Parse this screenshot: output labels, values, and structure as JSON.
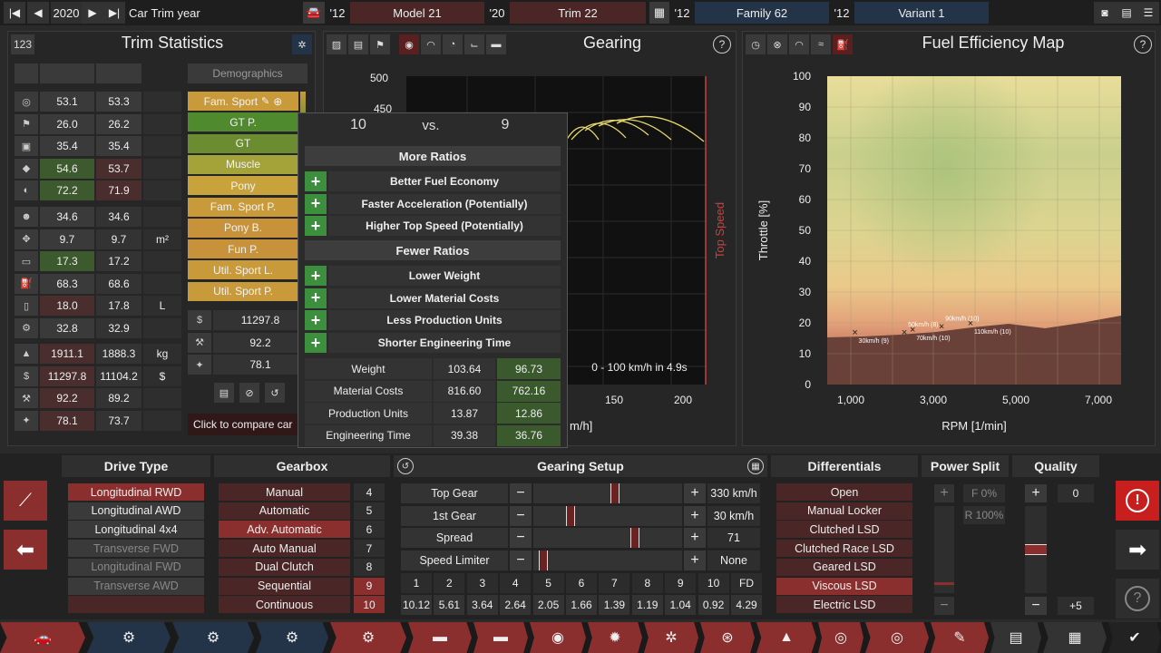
{
  "topbar": {
    "year": "2020",
    "year_label": "Car Trim year",
    "model_year": "'12",
    "model": "Model 21",
    "trim_year": "'20",
    "trim": "Trim 22",
    "family_year": "'12",
    "family": "Family 62",
    "variant_year": "'12",
    "variant": "Variant 1"
  },
  "trim_stats": {
    "badge": "123",
    "title": "Trim Statistics",
    "demographics_label": "Demographics",
    "rows_a": [
      {
        "icon": "steering-icon",
        "v1": "53.1",
        "v2": "53.3",
        "unit": "",
        "c1": "#3a3a3a",
        "c2": "#3a3a3a"
      },
      {
        "icon": "race-flag-icon",
        "v1": "26.0",
        "v2": "26.2",
        "unit": "",
        "c1": "#3a3a3a",
        "c2": "#3a3a3a"
      },
      {
        "icon": "seat-icon",
        "v1": "35.4",
        "v2": "35.4",
        "unit": "",
        "c1": "#3a3a3a",
        "c2": "#3a3a3a"
      },
      {
        "icon": "diamond-icon",
        "v1": "54.6",
        "v2": "53.7",
        "unit": "",
        "c1": "#3d5a2e",
        "c2": "#4a2e2e"
      },
      {
        "icon": "safety-icon",
        "v1": "72.2",
        "v2": "71.9",
        "unit": "",
        "c1": "#3d5a2e",
        "c2": "#4a2e2e"
      }
    ],
    "rows_b": [
      {
        "icon": "passengers-icon",
        "v1": "34.6",
        "v2": "34.6",
        "unit": ""
      },
      {
        "icon": "dimensions-icon",
        "v1": "9.7",
        "v2": "9.7",
        "unit": "m²"
      },
      {
        "icon": "cargo-icon",
        "v1": "17.3",
        "v2": "17.2",
        "unit": "",
        "c1": "#3d5a2e"
      },
      {
        "icon": "fuel-icon",
        "v1": "68.3",
        "v2": "68.6",
        "unit": ""
      },
      {
        "icon": "fuel-tank-icon",
        "v1": "18.0",
        "v2": "17.8",
        "unit": "L",
        "c1": "#4a2e2e"
      },
      {
        "icon": "car-service-icon",
        "v1": "32.8",
        "v2": "32.9",
        "unit": ""
      }
    ],
    "rows_c": [
      {
        "icon": "weight-icon",
        "v1": "1911.1",
        "v2": "1888.3",
        "unit": "kg",
        "c1": "#4a2e2e"
      },
      {
        "icon": "cost-icon",
        "v1": "11297.8",
        "v2": "11104.2",
        "unit": "$",
        "c1": "#4a2e2e"
      },
      {
        "icon": "production-icon",
        "v1": "92.2",
        "v2": "89.2",
        "unit": "",
        "c1": "#4a2e2e"
      },
      {
        "icon": "engineering-icon",
        "v1": "78.1",
        "v2": "73.7",
        "unit": "",
        "c1": "#4a2e2e"
      }
    ],
    "demographics": [
      {
        "label": "Fam. Sport",
        "color": "#c89a3a"
      },
      {
        "label": "GT P.",
        "color": "#4f8a2e"
      },
      {
        "label": "GT",
        "color": "#6b8c30"
      },
      {
        "label": "Muscle",
        "color": "#a3a33a"
      },
      {
        "label": "Pony",
        "color": "#c8a23a"
      },
      {
        "label": "Fam. Sport P.",
        "color": "#c89a3a"
      },
      {
        "label": "Pony B.",
        "color": "#c8923a"
      },
      {
        "label": "Fun P.",
        "color": "#c8923a"
      },
      {
        "label": "Util. Sport L.",
        "color": "#c89a3a"
      },
      {
        "label": "Util. Sport P.",
        "color": "#c89a3a"
      }
    ],
    "summary": [
      {
        "icon": "cost-icon",
        "value": "11297.8"
      },
      {
        "icon": "production-icon",
        "value": "92.2"
      },
      {
        "icon": "engineering-icon",
        "value": "78.1"
      }
    ],
    "compare_text": "Click to compare car"
  },
  "popup": {
    "left": "10",
    "vs": "vs.",
    "right": "9",
    "more_title": "More Ratios",
    "more": [
      "Better Fuel Economy",
      "Faster Acceleration (Potentially)",
      "Higher Top Speed (Potentially)"
    ],
    "fewer_title": "Fewer Ratios",
    "fewer": [
      "Lower Weight",
      "Lower Material Costs",
      "Less Production Units",
      "Shorter Engineering Time"
    ],
    "stats": [
      {
        "label": "Weight",
        "a": "103.64",
        "b": "96.73"
      },
      {
        "label": "Material Costs",
        "a": "816.60",
        "b": "762.16"
      },
      {
        "label": "Production Units",
        "a": "13.87",
        "b": "12.86"
      },
      {
        "label": "Engineering Time",
        "a": "39.38",
        "b": "36.76"
      }
    ]
  },
  "gearing": {
    "title": "Gearing",
    "y_ticks": [
      "500",
      "450"
    ],
    "x_ticks": [
      "150",
      "200"
    ],
    "x_label_partial": "m/h]",
    "top_speed_label": "Top Speed",
    "accel_text": "0 - 100 km/h in 4.9s"
  },
  "fuel_map": {
    "title": "Fuel Efficiency Map",
    "ylabel": "Throttle [%]",
    "xlabel": "RPM [1/min]",
    "y_ticks": [
      "100",
      "90",
      "80",
      "70",
      "60",
      "50",
      "40",
      "30",
      "20",
      "10",
      "0"
    ],
    "x_ticks": [
      "1,000",
      "3,000",
      "5,000",
      "7,000"
    ],
    "points": [
      {
        "label": "30km/h (9)",
        "rpm": 1100,
        "thr": 17
      },
      {
        "label": "50km/h (8)",
        "rpm": 2300,
        "thr": 17
      },
      {
        "label": "70km/h (10)",
        "rpm": 2500,
        "thr": 18
      },
      {
        "label": "90km/h (10)",
        "rpm": 3200,
        "thr": 19
      },
      {
        "label": "110km/h (10)",
        "rpm": 3900,
        "thr": 20
      }
    ]
  },
  "drive_type": {
    "title": "Drive Type",
    "options": [
      {
        "label": "Longitudinal RWD",
        "state": "sel"
      },
      {
        "label": "Longitudinal AWD",
        "state": ""
      },
      {
        "label": "Longitudinal 4x4",
        "state": ""
      },
      {
        "label": "Transverse FWD",
        "state": "dis"
      },
      {
        "label": "Longitudinal FWD",
        "state": "dis"
      },
      {
        "label": "Transverse AWD",
        "state": "dis"
      }
    ]
  },
  "gearbox": {
    "title": "Gearbox",
    "options": [
      {
        "label": "Manual",
        "state": ""
      },
      {
        "label": "Automatic",
        "state": ""
      },
      {
        "label": "Adv. Automatic",
        "state": "sel"
      },
      {
        "label": "Auto Manual",
        "state": ""
      },
      {
        "label": "Dual Clutch",
        "state": ""
      },
      {
        "label": "Sequential",
        "state": ""
      },
      {
        "label": "Continuous",
        "state": ""
      }
    ],
    "gears": [
      "4",
      "5",
      "6",
      "7",
      "8",
      "9",
      "10"
    ]
  },
  "gearing_setup": {
    "title": "Gearing Setup",
    "rows": [
      {
        "label": "Top Gear",
        "value": "330 km/h",
        "pos": 0.55
      },
      {
        "label": "1st Gear",
        "value": "30 km/h",
        "pos": 0.25
      },
      {
        "label": "Spread",
        "value": "71",
        "pos": 0.68
      },
      {
        "label": "Speed Limiter",
        "value": "None",
        "pos": 0.07
      }
    ],
    "gear_numbers": [
      "1",
      "2",
      "3",
      "4",
      "5",
      "6",
      "7",
      "8",
      "9",
      "10",
      "FD"
    ],
    "gear_ratios": [
      "10.12",
      "5.61",
      "3.64",
      "2.64",
      "2.05",
      "1.66",
      "1.39",
      "1.19",
      "1.04",
      "0.92",
      "4.29"
    ]
  },
  "differentials": {
    "title": "Differentials",
    "options": [
      {
        "label": "Open",
        "state": ""
      },
      {
        "label": "Manual Locker",
        "state": ""
      },
      {
        "label": "Clutched LSD",
        "state": ""
      },
      {
        "label": "Clutched Race LSD",
        "state": ""
      },
      {
        "label": "Geared LSD",
        "state": ""
      },
      {
        "label": "Viscous LSD",
        "state": "sel"
      },
      {
        "label": "Electric LSD",
        "state": ""
      }
    ]
  },
  "power_split": {
    "title": "Power Split",
    "front": "F 0%",
    "rear": "R 100%",
    "level": 0.0
  },
  "quality": {
    "title": "Quality",
    "value": "0",
    "bonus": "+5",
    "level": 0.5
  },
  "colors": {
    "accent_red": "#8a2e2e",
    "alert_red": "#c81e1e",
    "green": "#3c8f3c"
  }
}
